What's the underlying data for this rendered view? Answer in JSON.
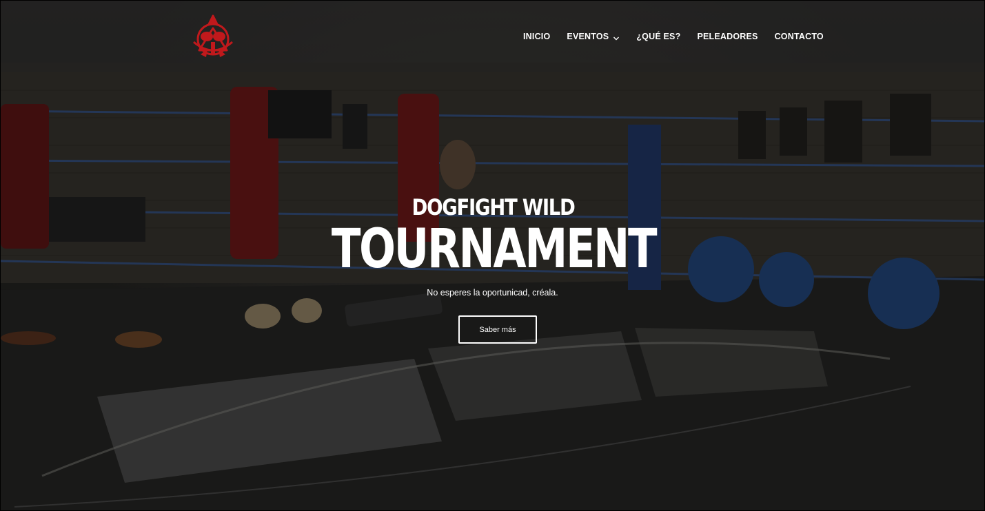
{
  "nav": {
    "items": [
      {
        "label": "INICIO"
      },
      {
        "label": "EVENTOS"
      },
      {
        "label": "¿QUÉ ES?"
      },
      {
        "label": "PELEADORES"
      },
      {
        "label": "CONTACTO"
      }
    ]
  },
  "hero": {
    "subtitle": "DOGFIGHT WILD",
    "title": "TOURNAMENT",
    "tagline": "No esperes la oportunicad, créala.",
    "button_label": "Saber más"
  },
  "colors": {
    "brand": "#c0191c",
    "text": "#ffffff",
    "header_overlay": "rgba(32,32,32,0.55)"
  },
  "icons": {
    "logo": "boxing-emblem-icon",
    "dropdown": "chevron-down-icon"
  }
}
